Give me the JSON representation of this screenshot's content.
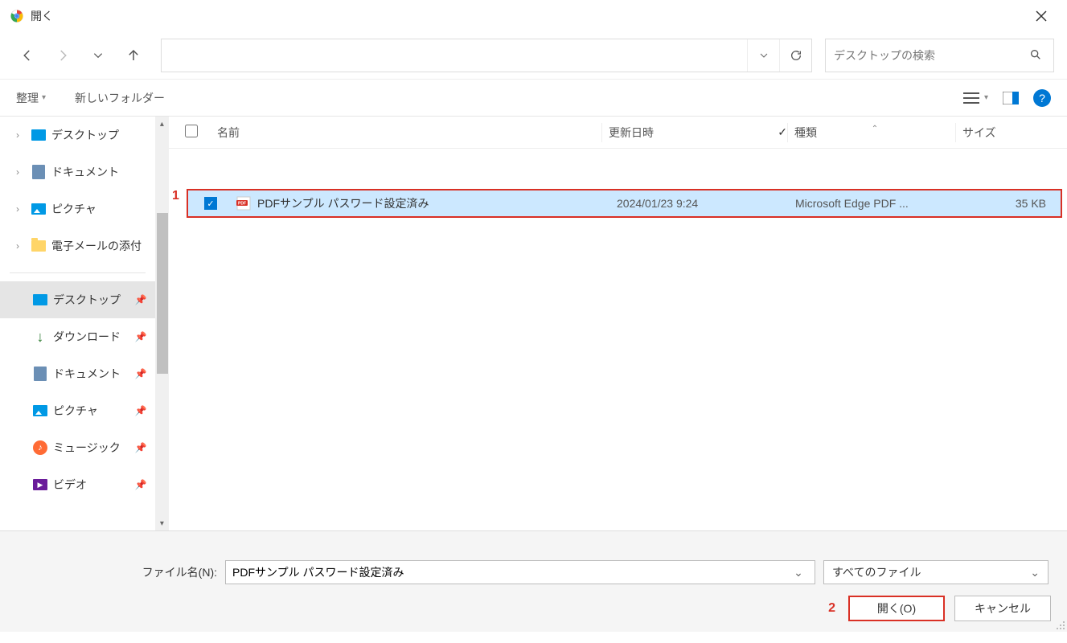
{
  "titlebar": {
    "title": "開く"
  },
  "toolbar": {
    "organize": "整理",
    "newFolder": "新しいフォルダー"
  },
  "search": {
    "placeholder": "デスクトップの検索"
  },
  "tree": {
    "top": [
      {
        "label": "デスクトップ"
      },
      {
        "label": "ドキュメント"
      },
      {
        "label": "ピクチャ"
      },
      {
        "label": "電子メールの添付"
      }
    ],
    "quick": [
      {
        "label": "デスクトップ"
      },
      {
        "label": "ダウンロード"
      },
      {
        "label": "ドキュメント"
      },
      {
        "label": "ピクチャ"
      },
      {
        "label": "ミュージック"
      },
      {
        "label": "ビデオ"
      }
    ]
  },
  "columns": {
    "name": "名前",
    "date": "更新日時",
    "type": "種類",
    "size": "サイズ"
  },
  "file": {
    "name": "PDFサンプル パスワード設定済み",
    "date": "2024/01/23 9:24",
    "type": "Microsoft Edge PDF ...",
    "size": "35 KB"
  },
  "footer": {
    "fileNameLabel": "ファイル名(N):",
    "fileName": "PDFサンプル パスワード設定済み",
    "filter": "すべてのファイル",
    "open": "開く(O)",
    "cancel": "キャンセル"
  },
  "annotations": {
    "one": "1",
    "two": "2"
  }
}
